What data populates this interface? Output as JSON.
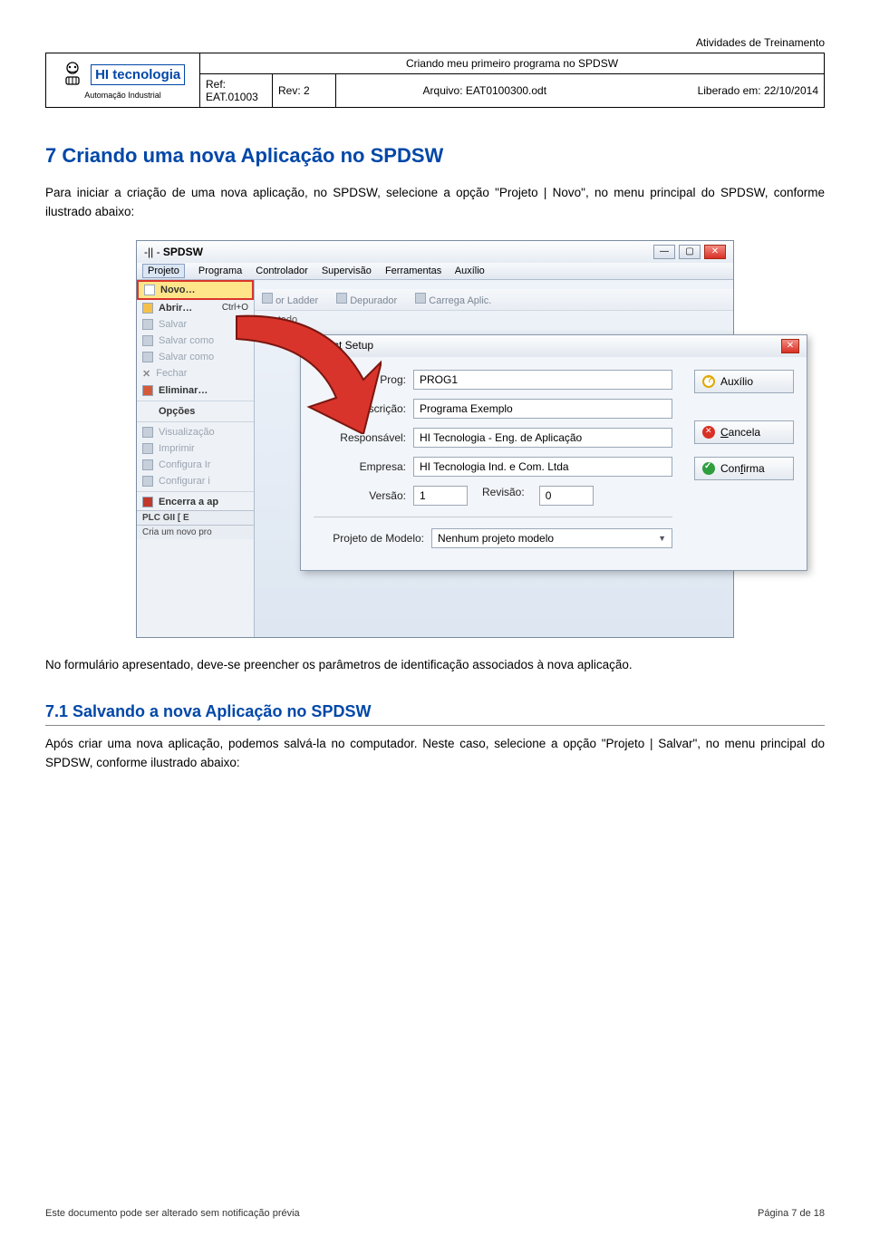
{
  "header": {
    "top_right": "Atividades de Treinamento",
    "logo_line1": "HI tecnologia",
    "logo_line2": "Automação Industrial",
    "doc_title": "Criando meu primeiro programa no SPDSW",
    "ref_label": "Ref: EAT.01003",
    "rev_label": "Rev: 2",
    "file_label": "Arquivo: EAT0100300.odt",
    "released_label": "Liberado em: 22/10/2014"
  },
  "section": {
    "num_title": "7  Criando uma nova Aplicação no SPDSW",
    "intro": "Para iniciar a criação de uma nova aplicação, no SPDSW, selecione a opção \"Projeto | Novo\", no menu principal do SPDSW, conforme ilustrado abaixo:",
    "after_img": "No formulário apresentado, deve-se preencher os parâmetros de identificação associados à nova aplicação.",
    "sub_title": "7.1  Salvando a nova Aplicação no SPDSW",
    "sub_body": "Após criar uma nova aplicação, podemos salvá-la no computador. Neste caso, selecione a opção \"Projeto | Salvar\", no menu principal do SPDSW, conforme ilustrado abaixo:"
  },
  "spdsw": {
    "win_prefix": "-|| -",
    "win_title": "SPDSW",
    "menu": {
      "m1": "Projeto",
      "m2": "Programa",
      "m3": "Controlador",
      "m4": "Supervisão",
      "m5": "Ferramentas",
      "m6": "Auxílio"
    },
    "file_menu": {
      "novo": "Novo…",
      "abrir": "Abrir…",
      "abrir_sc": "Ctrl+O",
      "salvar": "Salvar",
      "salvar_como": "Salvar como",
      "salvar_como2": "Salvar como",
      "fechar": "Fechar",
      "eliminar": "Eliminar…",
      "opcoes": "Opções",
      "visualizacao": "Visualização",
      "imprimir": "Imprimir",
      "configura_ir": "Configura Ir",
      "configurar_i": "Configurar i",
      "encerra": "Encerra a ap"
    },
    "toolbar": {
      "t1": "or Ladder",
      "t2": "Depurador",
      "t3": "Carrega Aplic."
    },
    "conn": "nectado",
    "plc_line": "PLC GII [ E",
    "status": "Cria um novo pro"
  },
  "dialog": {
    "title": "Project Setup",
    "l_prog": "Nome do Prog:",
    "v_prog": "PROG1",
    "l_desc": "Descrição:",
    "v_desc": "Programa Exemplo",
    "l_resp": "Responsável:",
    "v_resp": "HI Tecnologia - Eng. de Aplicação",
    "l_emp": "Empresa:",
    "v_emp": "HI Tecnologia Ind. e Com. Ltda",
    "l_ver": "Versão:",
    "v_ver": "1",
    "l_rev": "Revisão:",
    "v_rev": "0",
    "l_model": "Projeto de Modelo:",
    "v_model": "Nenhum projeto modelo",
    "btn_help": "Auxílio",
    "btn_cancel": "Cancela",
    "btn_ok": "Confirma"
  },
  "footer": {
    "left": "Este documento pode ser alterado sem notificação prévia",
    "right": "Página 7 de 18"
  }
}
